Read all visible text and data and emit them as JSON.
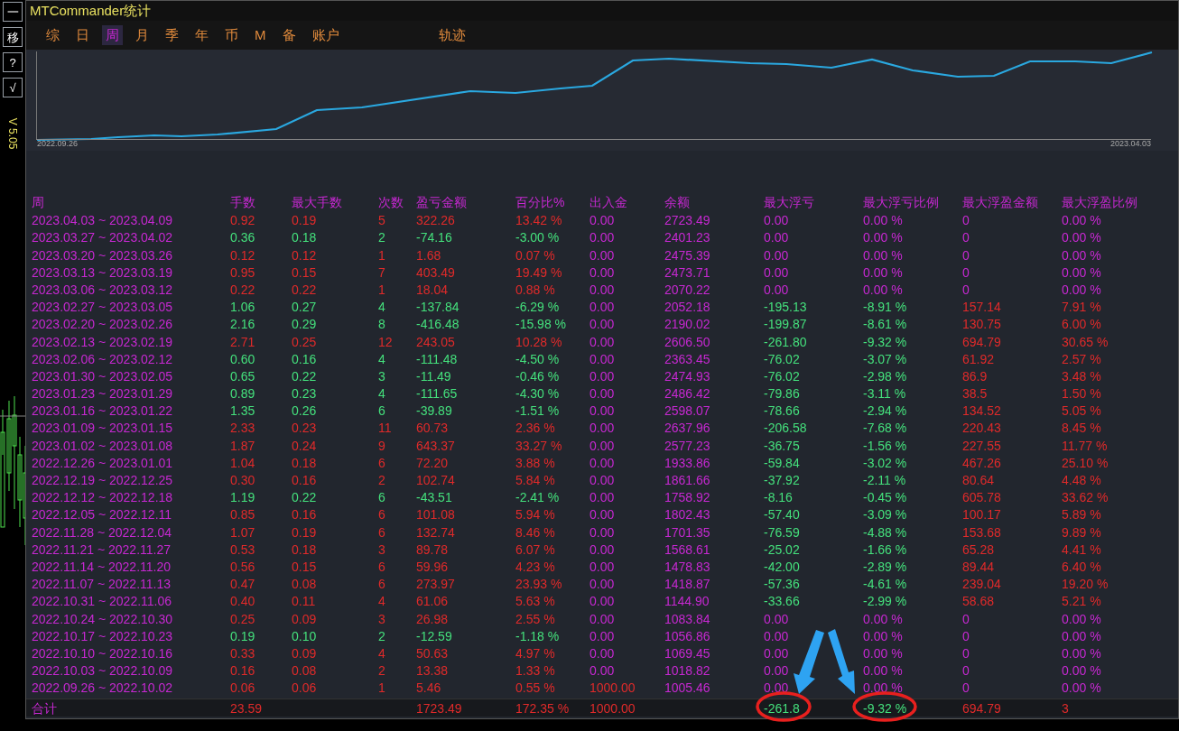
{
  "side_buttons": [
    "一",
    "移",
    "?",
    "√"
  ],
  "version": "V 5.05",
  "window": {
    "title": "MTCommander统计"
  },
  "tabs": [
    {
      "label": "综",
      "selected": false
    },
    {
      "label": "日",
      "selected": false
    },
    {
      "label": "周",
      "selected": true
    },
    {
      "label": "月",
      "selected": false
    },
    {
      "label": "季",
      "selected": false
    },
    {
      "label": "年",
      "selected": false
    },
    {
      "label": "币",
      "selected": false
    },
    {
      "label": "M",
      "selected": false
    },
    {
      "label": "备",
      "selected": false
    },
    {
      "label": "账户",
      "selected": false
    }
  ],
  "trail_tab": {
    "label": "轨迹",
    "selected": false
  },
  "chart": {
    "start_label": "2022.09.26",
    "end_label": "2023.04.03"
  },
  "table": {
    "columns": [
      "周",
      "手数",
      "最大手数",
      "次数",
      "盈亏金额",
      "百分比%",
      "出入金",
      "余额",
      "最大浮亏",
      "最大浮亏比例",
      "最大浮盈金额",
      "最大浮盈比例"
    ],
    "rows": [
      {
        "cells": [
          "2023.04.03 ~ 2023.04.09",
          "0.92",
          "0.19",
          "5",
          "322.26",
          "13.42 %",
          "0.00",
          "2723.49",
          "0.00",
          "0.00 %",
          "0",
          "0.00 %"
        ],
        "loss": false,
        "deposit": false,
        "float_loss": false,
        "float_gain": false
      },
      {
        "cells": [
          "2023.03.27 ~ 2023.04.02",
          "0.36",
          "0.18",
          "2",
          "-74.16",
          "-3.00 %",
          "0.00",
          "2401.23",
          "0.00",
          "0.00 %",
          "0",
          "0.00 %"
        ],
        "loss": true,
        "deposit": false,
        "float_loss": false,
        "float_gain": false
      },
      {
        "cells": [
          "2023.03.20 ~ 2023.03.26",
          "0.12",
          "0.12",
          "1",
          "1.68",
          "0.07 %",
          "0.00",
          "2475.39",
          "0.00",
          "0.00 %",
          "0",
          "0.00 %"
        ],
        "loss": false,
        "deposit": false,
        "float_loss": false,
        "float_gain": false
      },
      {
        "cells": [
          "2023.03.13 ~ 2023.03.19",
          "0.95",
          "0.15",
          "7",
          "403.49",
          "19.49 %",
          "0.00",
          "2473.71",
          "0.00",
          "0.00 %",
          "0",
          "0.00 %"
        ],
        "loss": false,
        "deposit": false,
        "float_loss": false,
        "float_gain": false
      },
      {
        "cells": [
          "2023.03.06 ~ 2023.03.12",
          "0.22",
          "0.22",
          "1",
          "18.04",
          "0.88 %",
          "0.00",
          "2070.22",
          "0.00",
          "0.00 %",
          "0",
          "0.00 %"
        ],
        "loss": false,
        "deposit": false,
        "float_loss": false,
        "float_gain": false
      },
      {
        "cells": [
          "2023.02.27 ~ 2023.03.05",
          "1.06",
          "0.27",
          "4",
          "-137.84",
          "-6.29 %",
          "0.00",
          "2052.18",
          "-195.13",
          "-8.91 %",
          "157.14",
          "7.91 %"
        ],
        "loss": true,
        "deposit": false,
        "float_loss": true,
        "float_gain": true
      },
      {
        "cells": [
          "2023.02.20 ~ 2023.02.26",
          "2.16",
          "0.29",
          "8",
          "-416.48",
          "-15.98 %",
          "0.00",
          "2190.02",
          "-199.87",
          "-8.61 %",
          "130.75",
          "6.00 %"
        ],
        "loss": true,
        "deposit": false,
        "float_loss": true,
        "float_gain": true
      },
      {
        "cells": [
          "2023.02.13 ~ 2023.02.19",
          "2.71",
          "0.25",
          "12",
          "243.05",
          "10.28 %",
          "0.00",
          "2606.50",
          "-261.80",
          "-9.32 %",
          "694.79",
          "30.65 %"
        ],
        "loss": false,
        "deposit": false,
        "float_loss": true,
        "float_gain": true
      },
      {
        "cells": [
          "2023.02.06 ~ 2023.02.12",
          "0.60",
          "0.16",
          "4",
          "-111.48",
          "-4.50 %",
          "0.00",
          "2363.45",
          "-76.02",
          "-3.07 %",
          "61.92",
          "2.57 %"
        ],
        "loss": true,
        "deposit": false,
        "float_loss": true,
        "float_gain": true
      },
      {
        "cells": [
          "2023.01.30 ~ 2023.02.05",
          "0.65",
          "0.22",
          "3",
          "-11.49",
          "-0.46 %",
          "0.00",
          "2474.93",
          "-76.02",
          "-2.98 %",
          "86.9",
          "3.48 %"
        ],
        "loss": true,
        "deposit": false,
        "float_loss": true,
        "float_gain": true
      },
      {
        "cells": [
          "2023.01.23 ~ 2023.01.29",
          "0.89",
          "0.23",
          "4",
          "-111.65",
          "-4.30 %",
          "0.00",
          "2486.42",
          "-79.86",
          "-3.11 %",
          "38.5",
          "1.50 %"
        ],
        "loss": true,
        "deposit": false,
        "float_loss": true,
        "float_gain": true
      },
      {
        "cells": [
          "2023.01.16 ~ 2023.01.22",
          "1.35",
          "0.26",
          "6",
          "-39.89",
          "-1.51 %",
          "0.00",
          "2598.07",
          "-78.66",
          "-2.94 %",
          "134.52",
          "5.05 %"
        ],
        "loss": true,
        "deposit": false,
        "float_loss": true,
        "float_gain": true
      },
      {
        "cells": [
          "2023.01.09 ~ 2023.01.15",
          "2.33",
          "0.23",
          "11",
          "60.73",
          "2.36 %",
          "0.00",
          "2637.96",
          "-206.58",
          "-7.68 %",
          "220.43",
          "8.45 %"
        ],
        "loss": false,
        "deposit": false,
        "float_loss": true,
        "float_gain": true
      },
      {
        "cells": [
          "2023.01.02 ~ 2023.01.08",
          "1.87",
          "0.24",
          "9",
          "643.37",
          "33.27 %",
          "0.00",
          "2577.23",
          "-36.75",
          "-1.56 %",
          "227.55",
          "11.77 %"
        ],
        "loss": false,
        "deposit": false,
        "float_loss": true,
        "float_gain": true
      },
      {
        "cells": [
          "2022.12.26 ~ 2023.01.01",
          "1.04",
          "0.18",
          "6",
          "72.20",
          "3.88 %",
          "0.00",
          "1933.86",
          "-59.84",
          "-3.02 %",
          "467.26",
          "25.10 %"
        ],
        "loss": false,
        "deposit": false,
        "float_loss": true,
        "float_gain": true
      },
      {
        "cells": [
          "2022.12.19 ~ 2022.12.25",
          "0.30",
          "0.16",
          "2",
          "102.74",
          "5.84 %",
          "0.00",
          "1861.66",
          "-37.92",
          "-2.11 %",
          "80.64",
          "4.48 %"
        ],
        "loss": false,
        "deposit": false,
        "float_loss": true,
        "float_gain": true
      },
      {
        "cells": [
          "2022.12.12 ~ 2022.12.18",
          "1.19",
          "0.22",
          "6",
          "-43.51",
          "-2.41 %",
          "0.00",
          "1758.92",
          "-8.16",
          "-0.45 %",
          "605.78",
          "33.62 %"
        ],
        "loss": true,
        "deposit": false,
        "float_loss": true,
        "float_gain": true
      },
      {
        "cells": [
          "2022.12.05 ~ 2022.12.11",
          "0.85",
          "0.16",
          "6",
          "101.08",
          "5.94 %",
          "0.00",
          "1802.43",
          "-57.40",
          "-3.09 %",
          "100.17",
          "5.89 %"
        ],
        "loss": false,
        "deposit": false,
        "float_loss": true,
        "float_gain": true
      },
      {
        "cells": [
          "2022.11.28 ~ 2022.12.04",
          "1.07",
          "0.19",
          "6",
          "132.74",
          "8.46 %",
          "0.00",
          "1701.35",
          "-76.59",
          "-4.88 %",
          "153.68",
          "9.89 %"
        ],
        "loss": false,
        "deposit": false,
        "float_loss": true,
        "float_gain": true
      },
      {
        "cells": [
          "2022.11.21 ~ 2022.11.27",
          "0.53",
          "0.18",
          "3",
          "89.78",
          "6.07 %",
          "0.00",
          "1568.61",
          "-25.02",
          "-1.66 %",
          "65.28",
          "4.41 %"
        ],
        "loss": false,
        "deposit": false,
        "float_loss": true,
        "float_gain": true
      },
      {
        "cells": [
          "2022.11.14 ~ 2022.11.20",
          "0.56",
          "0.15",
          "6",
          "59.96",
          "4.23 %",
          "0.00",
          "1478.83",
          "-42.00",
          "-2.89 %",
          "89.44",
          "6.40 %"
        ],
        "loss": false,
        "deposit": false,
        "float_loss": true,
        "float_gain": true
      },
      {
        "cells": [
          "2022.11.07 ~ 2022.11.13",
          "0.47",
          "0.08",
          "6",
          "273.97",
          "23.93 %",
          "0.00",
          "1418.87",
          "-57.36",
          "-4.61 %",
          "239.04",
          "19.20 %"
        ],
        "loss": false,
        "deposit": false,
        "float_loss": true,
        "float_gain": true
      },
      {
        "cells": [
          "2022.10.31 ~ 2022.11.06",
          "0.40",
          "0.11",
          "4",
          "61.06",
          "5.63 %",
          "0.00",
          "1144.90",
          "-33.66",
          "-2.99 %",
          "58.68",
          "5.21 %"
        ],
        "loss": false,
        "deposit": false,
        "float_loss": true,
        "float_gain": true
      },
      {
        "cells": [
          "2022.10.24 ~ 2022.10.30",
          "0.25",
          "0.09",
          "3",
          "26.98",
          "2.55 %",
          "0.00",
          "1083.84",
          "0.00",
          "0.00 %",
          "0",
          "0.00 %"
        ],
        "loss": false,
        "deposit": false,
        "float_loss": false,
        "float_gain": false
      },
      {
        "cells": [
          "2022.10.17 ~ 2022.10.23",
          "0.19",
          "0.10",
          "2",
          "-12.59",
          "-1.18 %",
          "0.00",
          "1056.86",
          "0.00",
          "0.00 %",
          "0",
          "0.00 %"
        ],
        "loss": true,
        "deposit": false,
        "float_loss": false,
        "float_gain": false
      },
      {
        "cells": [
          "2022.10.10 ~ 2022.10.16",
          "0.33",
          "0.09",
          "4",
          "50.63",
          "4.97 %",
          "0.00",
          "1069.45",
          "0.00",
          "0.00 %",
          "0",
          "0.00 %"
        ],
        "loss": false,
        "deposit": false,
        "float_loss": false,
        "float_gain": false
      },
      {
        "cells": [
          "2022.10.03 ~ 2022.10.09",
          "0.16",
          "0.08",
          "2",
          "13.38",
          "1.33 %",
          "0.00",
          "1018.82",
          "0.00",
          "0.00 %",
          "0",
          "0.00 %"
        ],
        "loss": false,
        "deposit": false,
        "float_loss": false,
        "float_gain": false
      },
      {
        "cells": [
          "2022.09.26 ~ 2022.10.02",
          "0.06",
          "0.06",
          "1",
          "5.46",
          "0.55 %",
          "1000.00",
          "1005.46",
          "0.00",
          "0.00 %",
          "0",
          "0.00 %"
        ],
        "loss": false,
        "deposit": true,
        "float_loss": false,
        "float_gain": false
      }
    ],
    "total": {
      "label": "合计",
      "lots": "23.59",
      "profit": "1723.49",
      "percent": "172.35 %",
      "deposit": "1000.00",
      "max_float_loss": "-261.8",
      "max_float_loss_pct": "-9.32 %",
      "max_float_gain": "694.79",
      "max_float_gain_pct": "3"
    }
  }
}
